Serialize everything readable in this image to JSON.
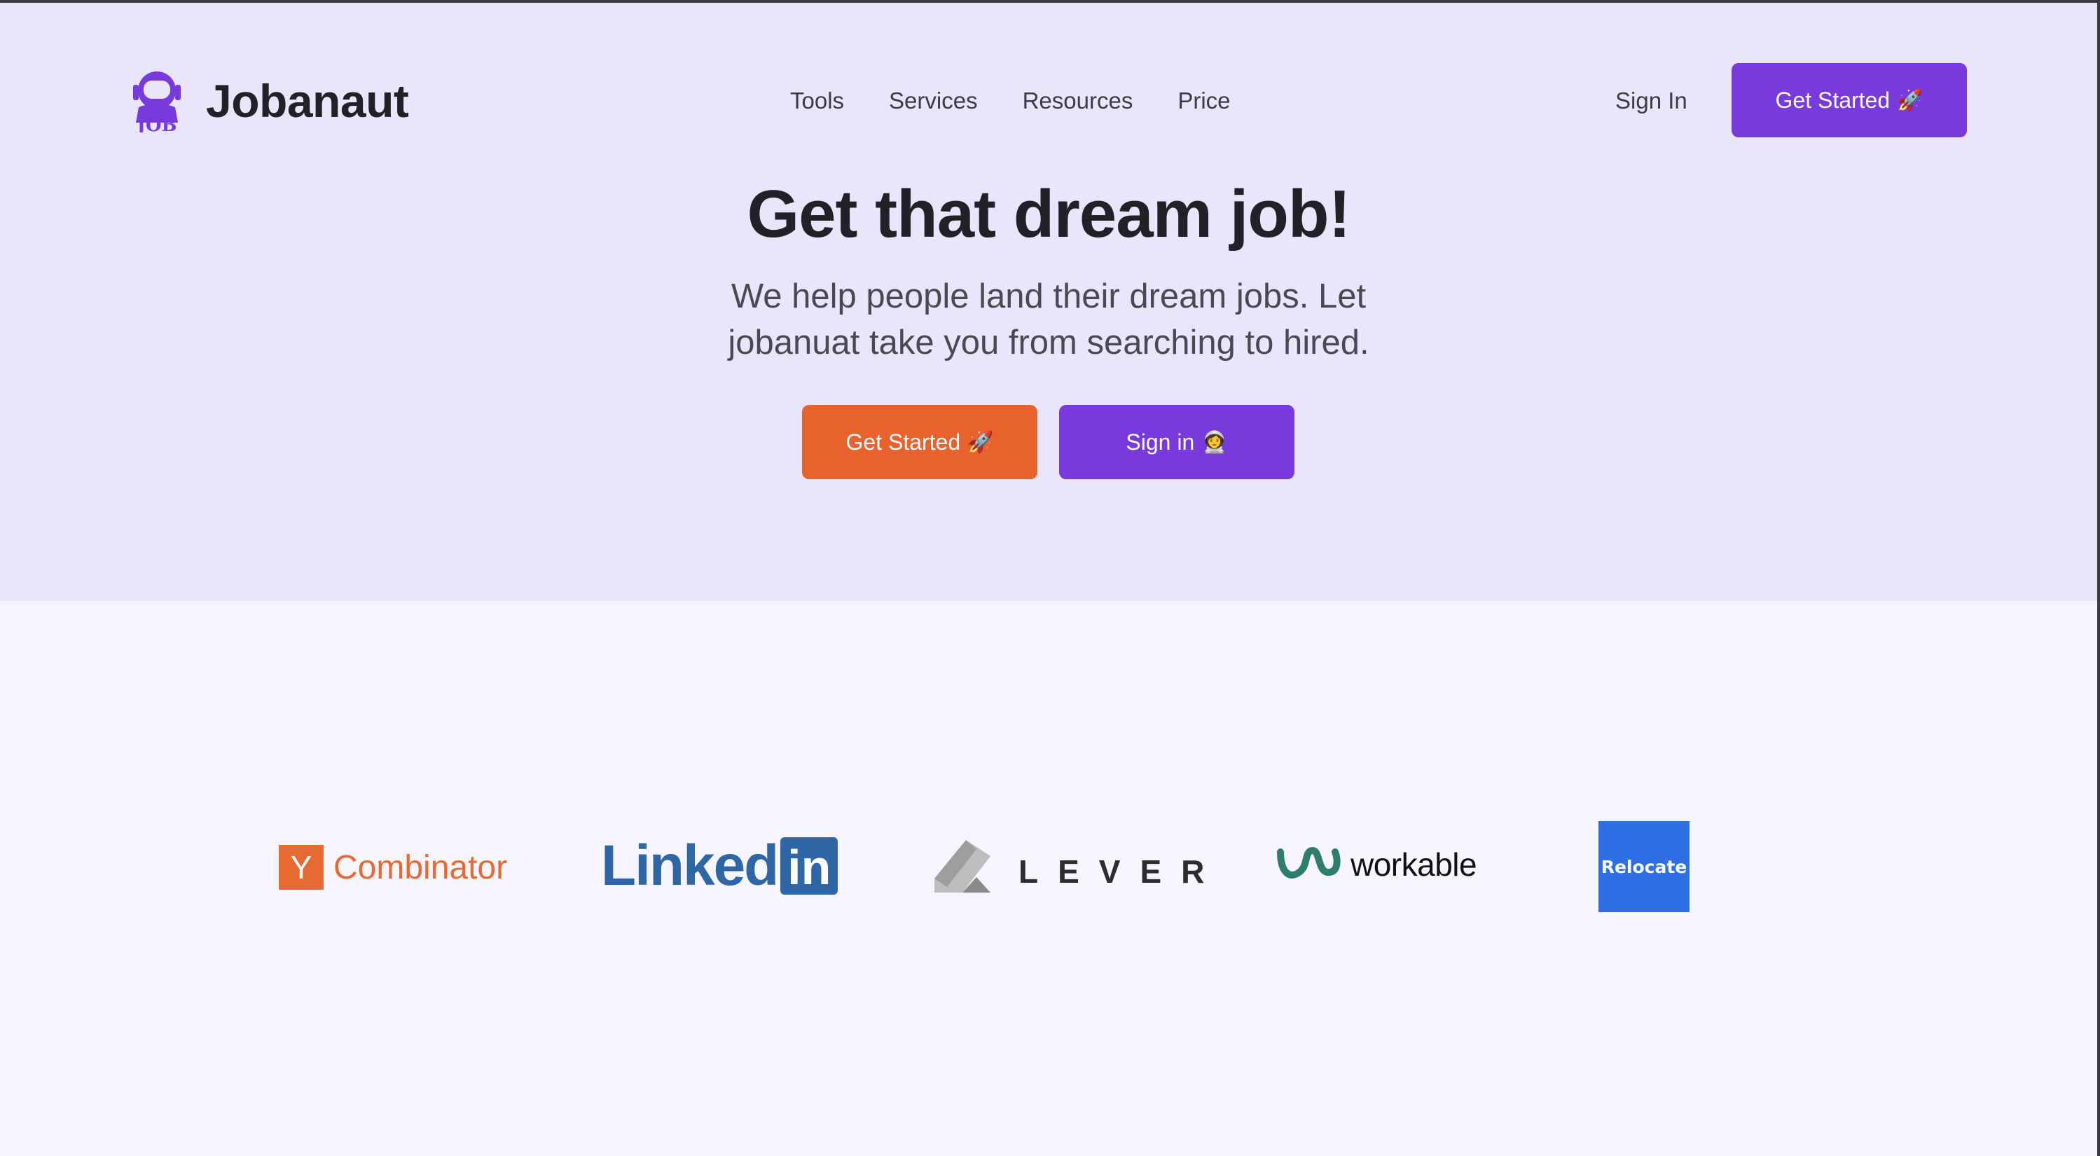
{
  "header": {
    "brand_name": "Jobanaut",
    "logo_icon": "astronaut-helmet-icon",
    "logo_badge_text": "JOB",
    "nav": [
      {
        "label": "Tools"
      },
      {
        "label": "Services"
      },
      {
        "label": "Resources"
      },
      {
        "label": "Price"
      }
    ],
    "sign_in_label": "Sign In",
    "get_started_label": "Get Started",
    "get_started_emoji": "🚀"
  },
  "hero": {
    "headline": "Get that dream job!",
    "subtitle": "We help people land their dream jobs. Let jobanuat take you from searching to hired.",
    "primary_button_label": "Get Started",
    "primary_button_emoji": "🚀",
    "secondary_button_label": "Sign in",
    "secondary_button_emoji": "👩‍🚀"
  },
  "partners": {
    "yc_letter": "Y",
    "yc_text": "Combinator",
    "linkedin_text": "Linked",
    "linkedin_box": "in",
    "lever_text": "LEVER",
    "workable_text": "workable",
    "relocate_text": "Relocate"
  },
  "colors": {
    "accent_purple": "#7839dd",
    "accent_orange": "#e8622e",
    "hero_background": "#e9e5fa",
    "page_background": "#f6f5fd",
    "linkedin_blue": "#2f67a6",
    "relocate_blue": "#2f6fe6",
    "yc_orange": "#e86a33",
    "workable_teal": "#2f7d6d"
  }
}
